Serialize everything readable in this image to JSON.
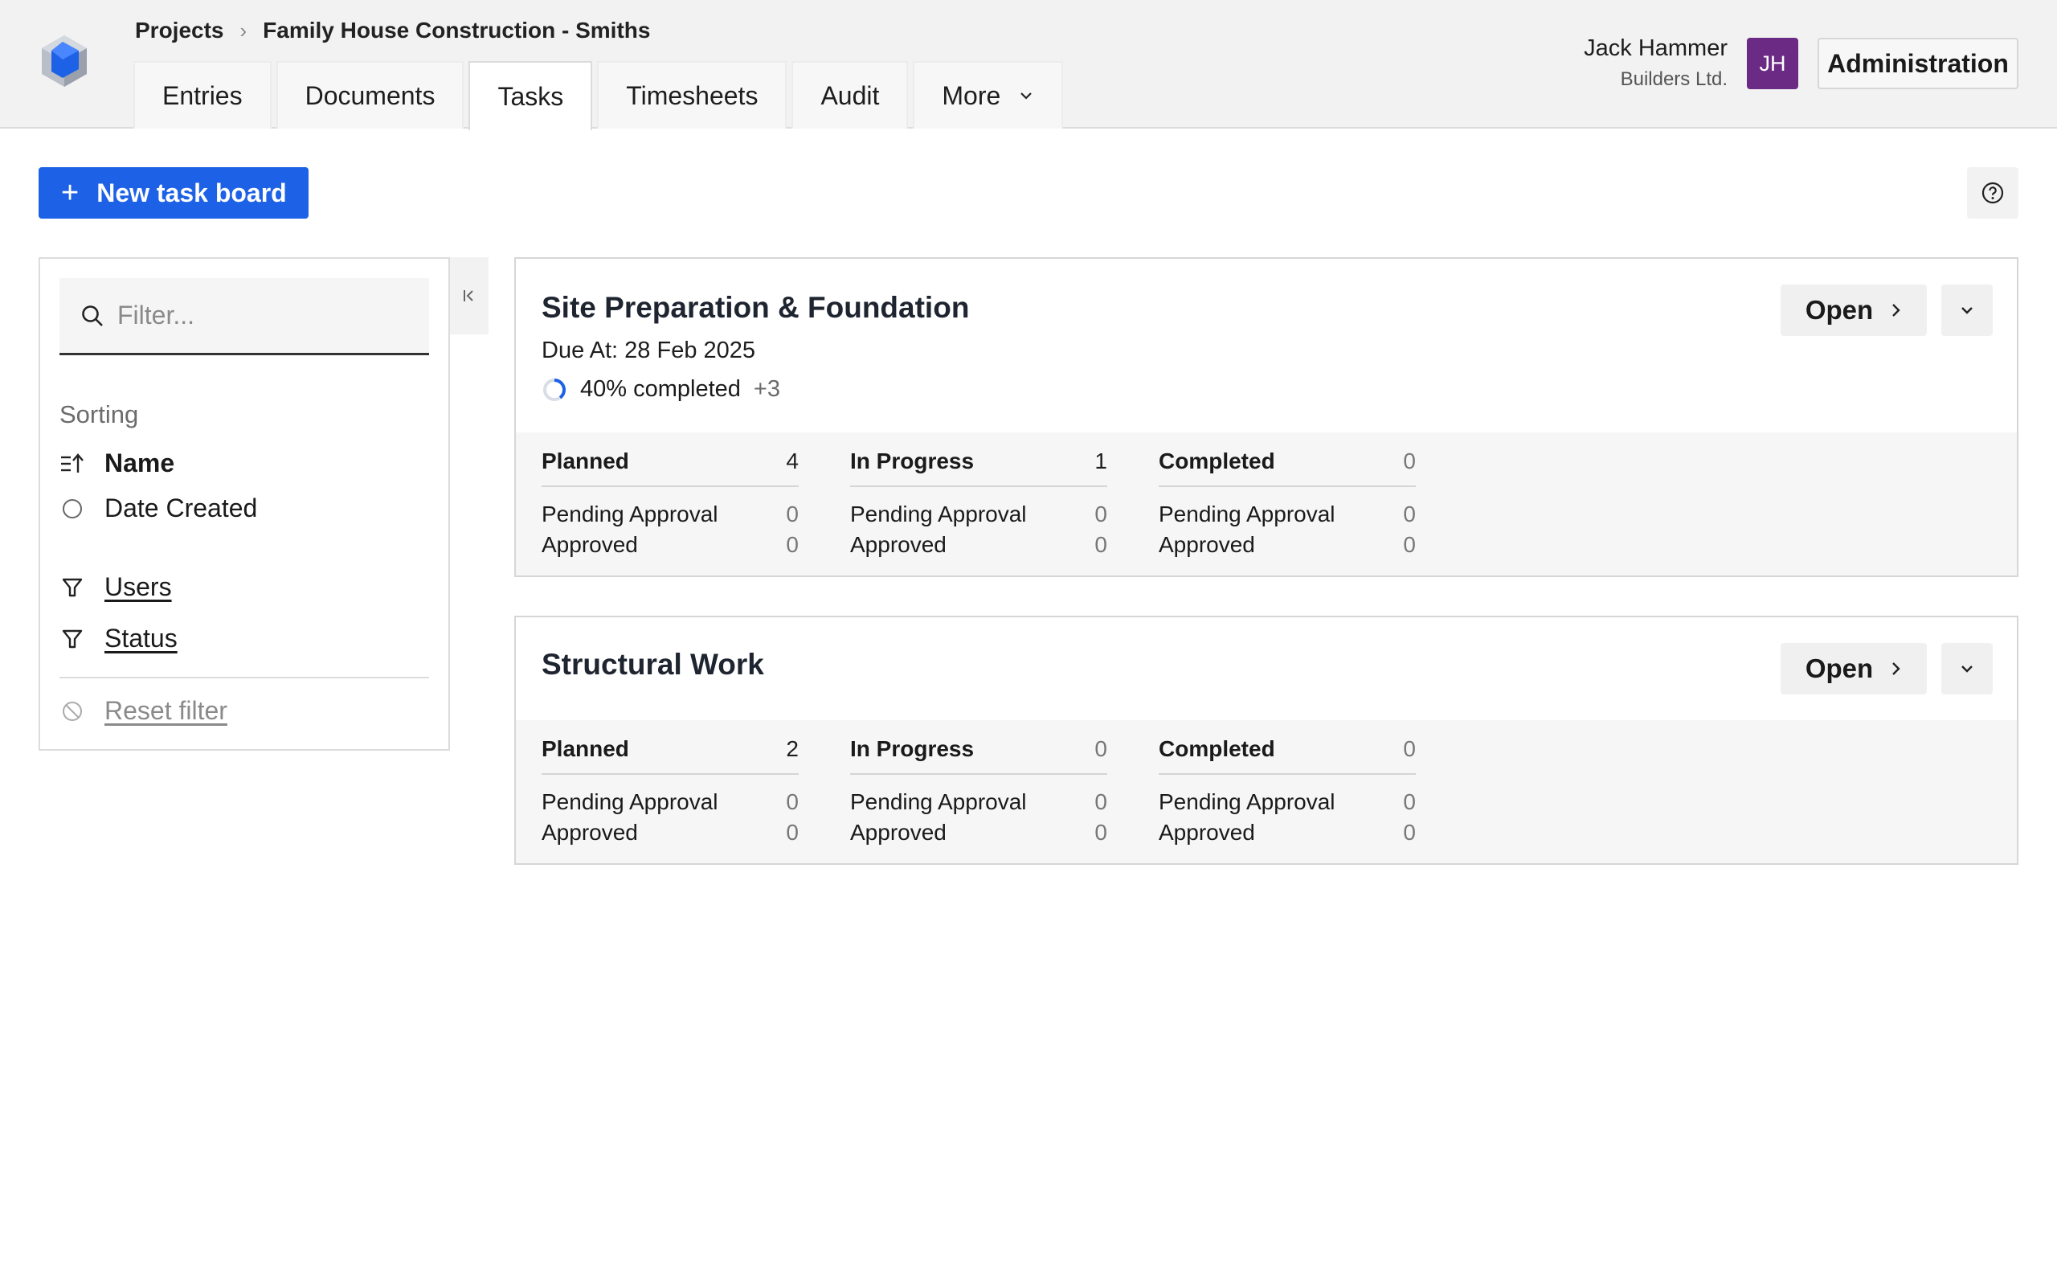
{
  "breadcrumb": {
    "root": "Projects",
    "current": "Family House Construction - Smiths"
  },
  "tabs": [
    {
      "label": "Entries"
    },
    {
      "label": "Documents"
    },
    {
      "label": "Tasks",
      "active": true
    },
    {
      "label": "Timesheets"
    },
    {
      "label": "Audit"
    },
    {
      "label": "More"
    }
  ],
  "user": {
    "name": "Jack Hammer",
    "org": "Builders Ltd.",
    "initials": "JH",
    "avatar_color": "#6b2a84"
  },
  "admin_label": "Administration",
  "toolbar": {
    "new_board_label": "New task board"
  },
  "sidebar": {
    "filter_placeholder": "Filter...",
    "sorting_label": "Sorting",
    "sort_name": "Name",
    "sort_date": "Date Created",
    "users_label": "Users",
    "status_label": "Status",
    "reset_label": "Reset filter"
  },
  "boards": [
    {
      "title": "Site Preparation & Foundation",
      "due": "Due At: 28 Feb 2025",
      "progress_text": "40% completed",
      "progress_value": 0.4,
      "extra": "+3",
      "open_label": "Open",
      "stats": [
        {
          "label": "Planned",
          "count": "4",
          "pending_label": "Pending Approval",
          "pending": "0",
          "approved_label": "Approved",
          "approved": "0"
        },
        {
          "label": "In Progress",
          "count": "1",
          "pending_label": "Pending Approval",
          "pending": "0",
          "approved_label": "Approved",
          "approved": "0"
        },
        {
          "label": "Completed",
          "count": "0",
          "pending_label": "Pending Approval",
          "pending": "0",
          "approved_label": "Approved",
          "approved": "0"
        }
      ]
    },
    {
      "title": "Structural Work",
      "open_label": "Open",
      "stats": [
        {
          "label": "Planned",
          "count": "2",
          "pending_label": "Pending Approval",
          "pending": "0",
          "approved_label": "Approved",
          "approved": "0"
        },
        {
          "label": "In Progress",
          "count": "0",
          "pending_label": "Pending Approval",
          "pending": "0",
          "approved_label": "Approved",
          "approved": "0"
        },
        {
          "label": "Completed",
          "count": "0",
          "pending_label": "Pending Approval",
          "pending": "0",
          "approved_label": "Approved",
          "approved": "0"
        }
      ]
    }
  ],
  "colors": {
    "primary": "#1d62e6",
    "progress": "#1d62e6"
  }
}
